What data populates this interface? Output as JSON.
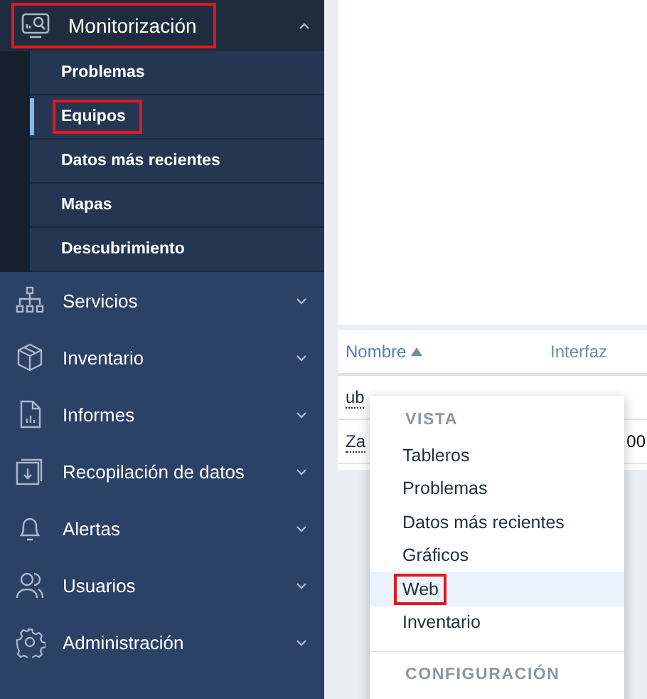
{
  "sidebar": {
    "open_section": {
      "label": "Monitorización",
      "expanded": true,
      "highlighted": true,
      "children": [
        {
          "label": "Problemas",
          "selected": false,
          "highlighted": false
        },
        {
          "label": "Equipos",
          "selected": true,
          "highlighted": true
        },
        {
          "label": "Datos más recientes",
          "selected": false,
          "highlighted": false
        },
        {
          "label": "Mapas",
          "selected": false,
          "highlighted": false
        },
        {
          "label": "Descubrimiento",
          "selected": false,
          "highlighted": false
        }
      ]
    },
    "items": [
      {
        "label": "Servicios",
        "kind": "services"
      },
      {
        "label": "Inventario",
        "kind": "inventory"
      },
      {
        "label": "Informes",
        "kind": "reports"
      },
      {
        "label": "Recopilación de datos",
        "kind": "collection"
      },
      {
        "label": "Alertas",
        "kind": "alerts"
      },
      {
        "label": "Usuarios",
        "kind": "users"
      },
      {
        "label": "Administración",
        "kind": "admin"
      }
    ]
  },
  "table": {
    "columns": [
      {
        "label": "Nombre",
        "sorted": true
      },
      {
        "label": "Interfaz",
        "sorted": false
      }
    ],
    "rows": [
      {
        "name": "ub"
      },
      {
        "name": "Za",
        "interface": "00"
      }
    ]
  },
  "context_menu": {
    "sections": [
      {
        "title": "VISTA",
        "items": [
          {
            "label": "Tableros",
            "selected": false,
            "highlighted": false
          },
          {
            "label": "Problemas",
            "selected": false,
            "highlighted": false
          },
          {
            "label": "Datos más recientes",
            "selected": false,
            "highlighted": false
          },
          {
            "label": "Gráficos",
            "selected": false,
            "highlighted": false
          },
          {
            "label": "Web",
            "selected": true,
            "highlighted": true
          },
          {
            "label": "Inventario",
            "selected": false,
            "highlighted": false
          }
        ]
      },
      {
        "title": "CONFIGURACIÓN"
      }
    ]
  }
}
